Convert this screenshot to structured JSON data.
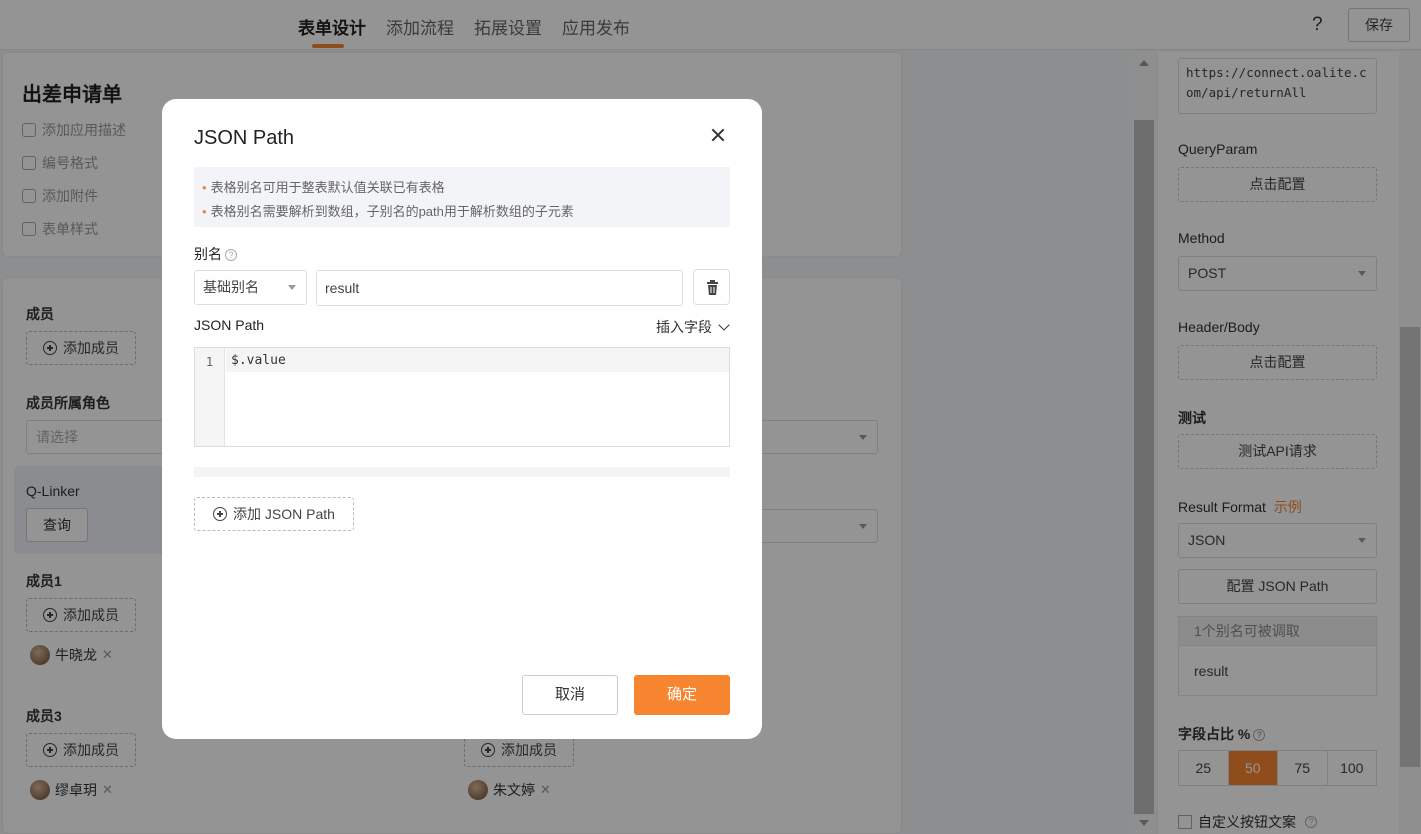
{
  "topbar": {
    "tabs": [
      {
        "label": "表单设计",
        "active": true
      },
      {
        "label": "添加流程",
        "active": false
      },
      {
        "label": "拓展设置",
        "active": false
      },
      {
        "label": "应用发布",
        "active": false
      }
    ],
    "help_label": "?",
    "save_label": "保存",
    "accent_color": "#f7852f"
  },
  "left": {
    "app_title": "出差申请单",
    "links": [
      {
        "label": "添加应用描述",
        "icon": "description-icon"
      },
      {
        "label": "编号格式",
        "icon": "number-icon"
      },
      {
        "label": "添加附件",
        "icon": "upload-icon"
      },
      {
        "label": "表单样式",
        "icon": "palette-icon"
      }
    ],
    "members_label": "成员",
    "add_member_label": "添加成员",
    "member_role_label": "成员所属角色",
    "select_placeholder": "请选择",
    "qlinker_label": "Q-Linker",
    "query_label": "查询",
    "member1_label": "成员1",
    "member1_chip": "牛晓龙",
    "member3_label": "成员3",
    "member3_chip": "缪卓玥",
    "member_right_chip": "朱文婷"
  },
  "right": {
    "url": "https://connect.oalite.com/api/returnAll",
    "query_param_label": "QueryParam",
    "click_config_label": "点击配置",
    "method_label": "Method",
    "method_value": "POST",
    "header_body_label": "Header/Body",
    "test_label": "测试",
    "test_api_label": "测试API请求",
    "result_format_label": "Result Format",
    "example_label": "示例",
    "result_format_value": "JSON",
    "config_json_path_label": "配置 JSON Path",
    "alias_count_label": "1个别名可被调取",
    "alias_item": "result",
    "field_ratio_label": "字段占比 %",
    "ratio_options": [
      "25",
      "50",
      "75",
      "100"
    ],
    "ratio_selected": "50",
    "custom_button_label": "自定义按钮文案"
  },
  "modal": {
    "title": "JSON Path",
    "tips": [
      "表格别名可用于整表默认值关联已有表格",
      "表格别名需要解析到数组，子别名的path用于解析数组的子元素"
    ],
    "alias_label": "别名",
    "alias_type": "基础别名",
    "alias_value": "result",
    "json_path_label": "JSON Path",
    "insert_field_label": "插入字段",
    "code_line_number": "1",
    "code_line": "$.value",
    "add_json_path_label": "添加 JSON Path",
    "cancel_label": "取消",
    "confirm_label": "确定"
  }
}
